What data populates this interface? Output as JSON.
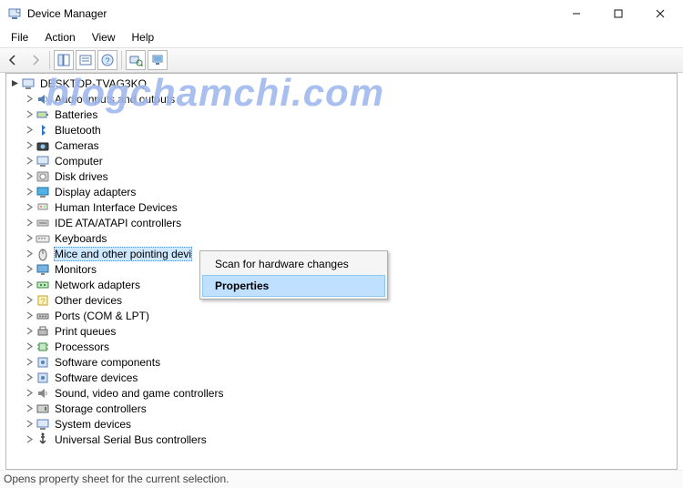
{
  "window": {
    "title": "Device Manager",
    "min": "–",
    "max": "▢",
    "close": "✕"
  },
  "menu": {
    "file": "File",
    "action": "Action",
    "view": "View",
    "help": "Help"
  },
  "watermark": "blogchamchi.com",
  "tree": {
    "root": "DESKTOP-TVAG3KQ",
    "items": [
      "Audio inputs and outputs",
      "Batteries",
      "Bluetooth",
      "Cameras",
      "Computer",
      "Disk drives",
      "Display adapters",
      "Human Interface Devices",
      "IDE ATA/ATAPI controllers",
      "Keyboards",
      "Mice and other pointing devices",
      "Monitors",
      "Network adapters",
      "Other devices",
      "Ports (COM & LPT)",
      "Print queues",
      "Processors",
      "Software components",
      "Software devices",
      "Sound, video and game controllers",
      "Storage controllers",
      "System devices",
      "Universal Serial Bus controllers"
    ]
  },
  "context_menu": {
    "scan": "Scan for hardware changes",
    "props": "Properties"
  },
  "statusbar": "Opens property sheet for the current selection."
}
